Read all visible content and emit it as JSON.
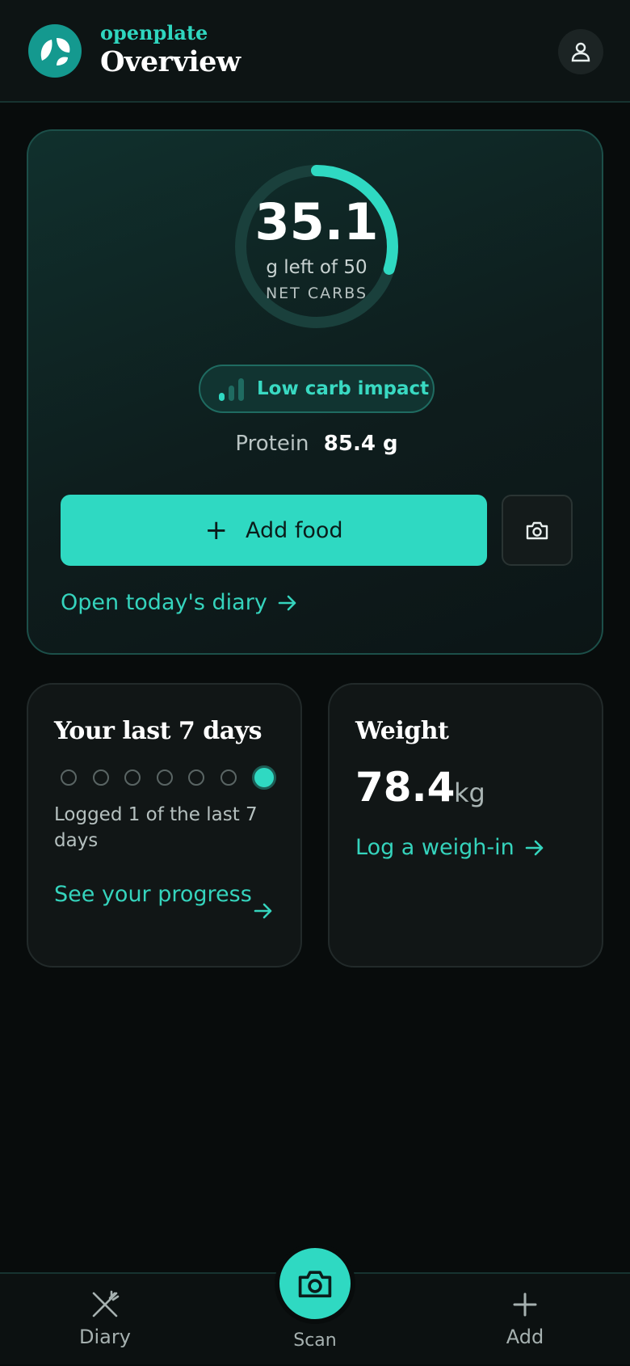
{
  "app": {
    "brand": "openplate",
    "title": "Overview"
  },
  "header": {
    "profile_icon": "user-icon"
  },
  "colors": {
    "accent": "#2fd9c2",
    "background": "#080c0c",
    "card": "#111616"
  },
  "summary": {
    "net_carbs_left": "35.1",
    "net_carbs_sub": "g left of 50",
    "net_carbs_label": "NET CARBS",
    "net_carbs_used_fraction": 0.298,
    "impact_label": "Low carb impact",
    "protein_label": "Protein",
    "protein_value": "85.4 g",
    "add_food_label": "Add food",
    "diary_link": "Open today's diary"
  },
  "last7": {
    "title": "Your last 7 days",
    "days_logged": [
      false,
      false,
      false,
      false,
      false,
      false,
      true
    ],
    "logged_text": "Logged 1 of the last 7 days",
    "progress_link": "See your progress"
  },
  "weight": {
    "title": "Weight",
    "value": "78.4",
    "unit": "kg",
    "log_link": "Log a weigh-in"
  },
  "nav": {
    "diary_label": "Diary",
    "scan_label": "Scan",
    "add_label": "Add"
  }
}
